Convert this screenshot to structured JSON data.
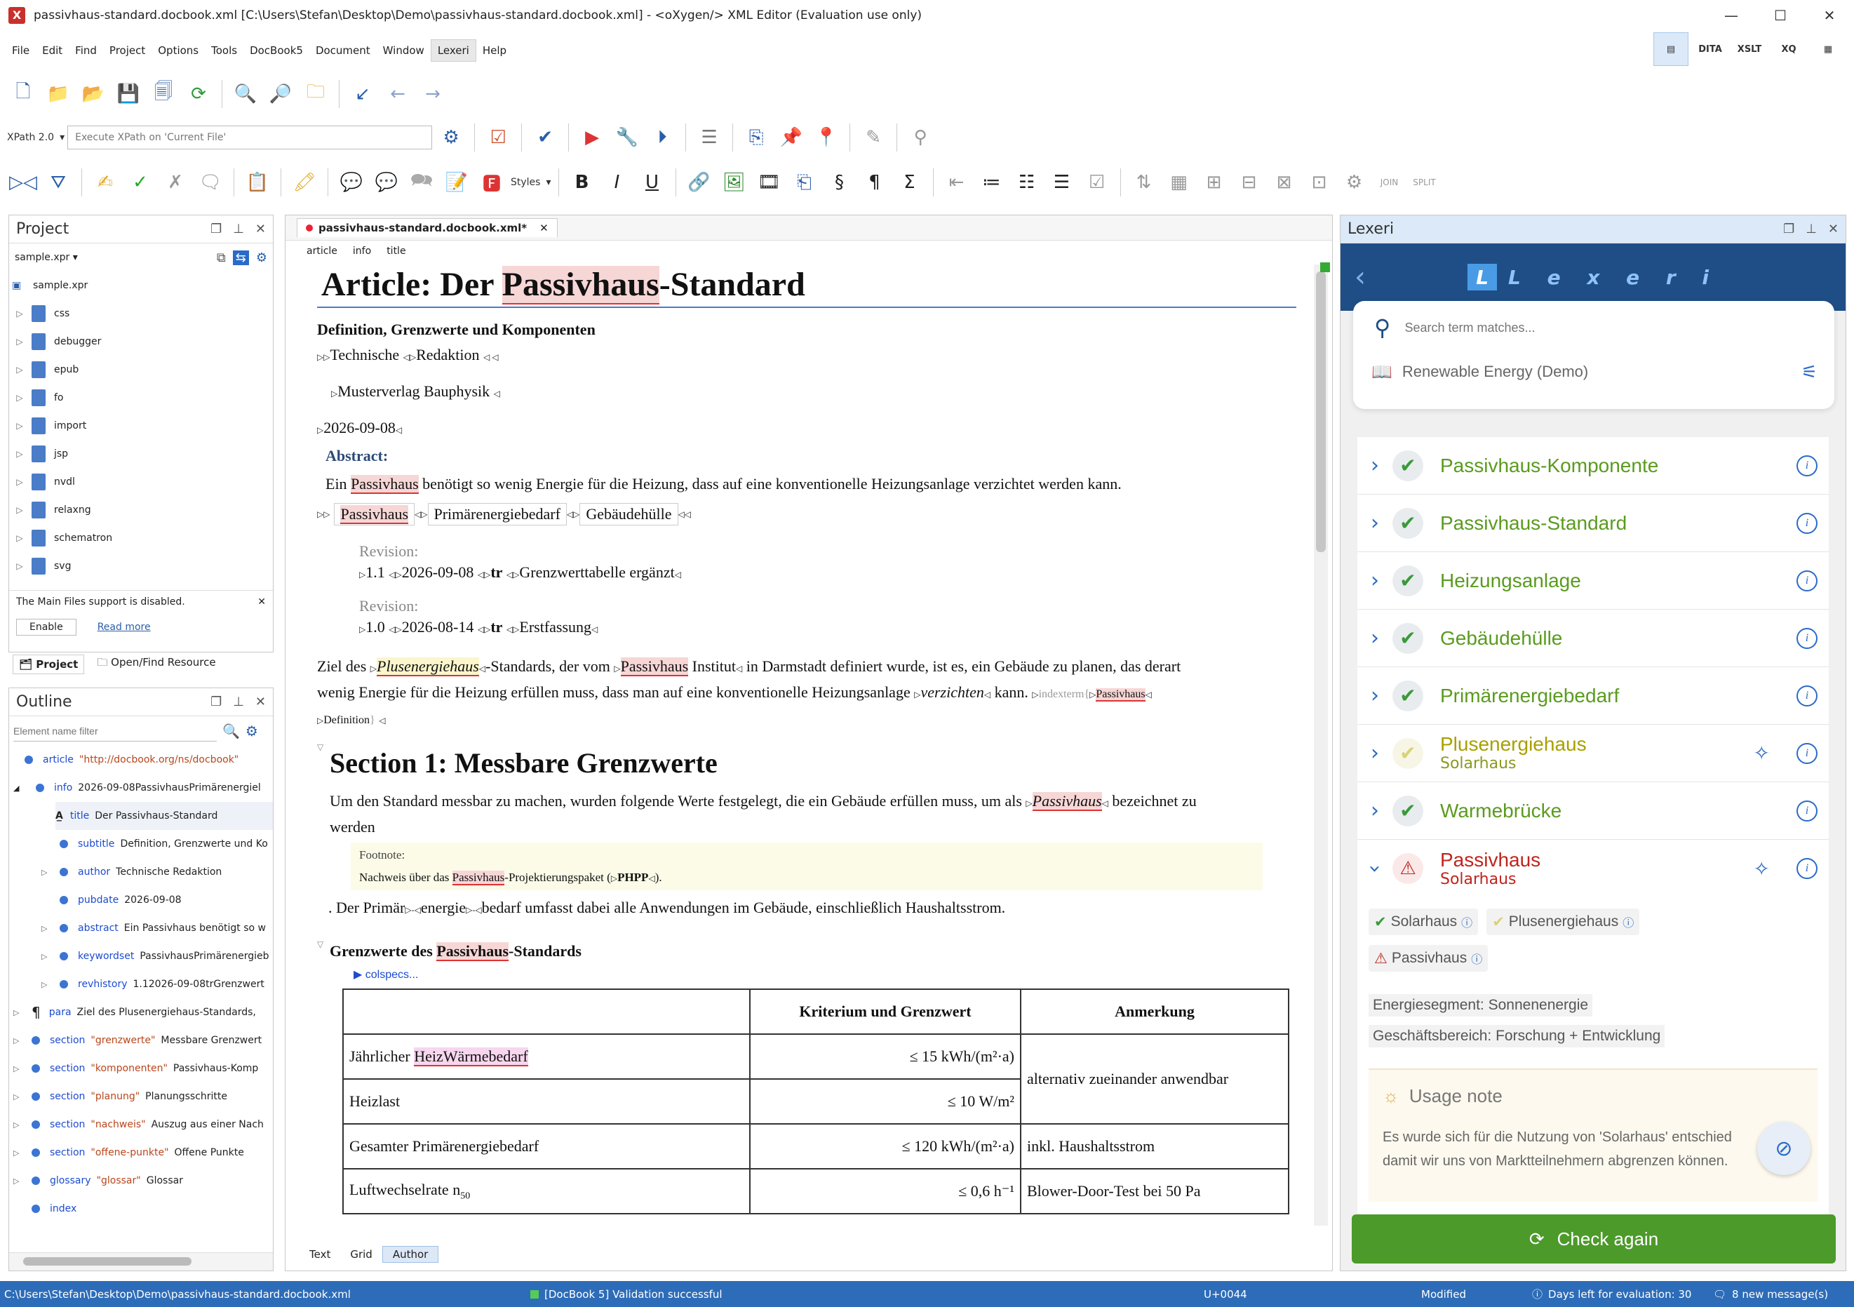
{
  "window": {
    "title": "passivhaus-standard.docbook.xml [C:\\Users\\Stefan\\Desktop\\Demo\\passivhaus-standard.docbook.xml] - <oXygen/> XML Editor (Evaluation use only)",
    "app_icon": "X",
    "minimize": "—",
    "maximize": "☐",
    "close": "✕"
  },
  "menu": [
    "File",
    "Edit",
    "Find",
    "Project",
    "Options",
    "Tools",
    "DocBook5",
    "Document",
    "Window",
    "Lexeri",
    "Help"
  ],
  "perspectives": [
    "",
    "DITA",
    "XSLT",
    "XQ",
    ""
  ],
  "xpath": {
    "version": "XPath 2.0",
    "placeholder": "Execute XPath on  'Current File'"
  },
  "styles_label": "Styles",
  "toolbar3_labels": {
    "join": "JOIN",
    "split": "SPLIT"
  },
  "project": {
    "title": "Project",
    "file": "sample.xpr",
    "items": [
      "sample.xpr",
      "css",
      "debugger",
      "epub",
      "fo",
      "import",
      "jsp",
      "nvdl",
      "relaxng",
      "schematron",
      "svg"
    ],
    "notice": "The Main Files support is disabled.",
    "enable": "Enable",
    "read_more": "Read more",
    "tabs": [
      "Project",
      "Open/Find Resource"
    ]
  },
  "outline": {
    "title": "Outline",
    "filter_placeholder": "Element name filter",
    "rows": [
      {
        "tag": "article",
        "attr": "\"http://docbook.org/ns/docbook\"",
        "text": ""
      },
      {
        "tag": "info",
        "attr": "",
        "text": "2026-09-08PassivhausPrimärenergiel"
      },
      {
        "tag": "title",
        "attr": "",
        "text": "Der Passivhaus-Standard"
      },
      {
        "tag": "subtitle",
        "attr": "",
        "text": "Definition, Grenzwerte und Ko"
      },
      {
        "tag": "author",
        "attr": "",
        "text": "Technische Redaktion"
      },
      {
        "tag": "pubdate",
        "attr": "",
        "text": "2026-09-08"
      },
      {
        "tag": "abstract",
        "attr": "",
        "text": "Ein Passivhaus benötigt so w"
      },
      {
        "tag": "keywordset",
        "attr": "",
        "text": "PassivhausPrimärenergieb"
      },
      {
        "tag": "revhistory",
        "attr": "",
        "text": "1.12026-09-08trGrenzwert"
      },
      {
        "tag": "para",
        "attr": "",
        "text": "Ziel des Plusenergiehaus-Standards,"
      },
      {
        "tag": "section",
        "attr": "\"grenzwerte\"",
        "text": "Messbare Grenzwert"
      },
      {
        "tag": "section",
        "attr": "\"komponenten\"",
        "text": "Passivhaus-Komp"
      },
      {
        "tag": "section",
        "attr": "\"planung\"",
        "text": "Planungsschritte"
      },
      {
        "tag": "section",
        "attr": "\"nachweis\"",
        "text": "Auszug aus einer Nach"
      },
      {
        "tag": "section",
        "attr": "\"offene-punkte\"",
        "text": "Offene Punkte"
      },
      {
        "tag": "glossary",
        "attr": "\"glossar\"",
        "text": "Glossar"
      },
      {
        "tag": "index",
        "attr": "",
        "text": ""
      }
    ]
  },
  "editor": {
    "tab": "passivhaus-standard.docbook.xml*",
    "breadcrumb": [
      "article",
      "info",
      "title"
    ],
    "title_pre": "Article: Der ",
    "title_term": "Passivhaus",
    "title_post": "-Standard",
    "subtitle": "Definition, Grenzwerte und Komponenten",
    "author": [
      "Technische",
      "Redaktion"
    ],
    "publisher": "Musterverlag Bauphysik",
    "pubdate": "2026-09-08",
    "abstract_label": "Abstract:",
    "abstract_pre": "Ein ",
    "abstract_term": "Passivhaus",
    "abstract_post": " benötigt so wenig Energie für die Heizung, dass auf eine konventionelle Heizungsanlage verzichtet werden kann.",
    "keywords": [
      "Passivhaus",
      "Primärenergiebedarf",
      "Gebäudehülle"
    ],
    "revision_label": "Revision:",
    "revisions": [
      {
        "num": "1.1",
        "date": "2026-09-08",
        "by": "tr",
        "remark": "Grenzwerttabelle ergänzt"
      },
      {
        "num": "1.0",
        "date": "2026-08-14",
        "by": "tr",
        "remark": "Erstfassung"
      }
    ],
    "para1": {
      "a": "Ziel des ",
      "b": "Plusenergiehaus",
      "c": "-Standards, der vom ",
      "d": "Passivhaus",
      "e": " Institut",
      "f": " in Darmstadt definiert wurde, ist es, ein Gebäude zu planen, das derart",
      "g": "wenig Energie für die Heizung erfüllen muss, dass man auf eine konventionelle Heizungsanlage ",
      "h": "verzichten",
      "i": " kann. ",
      "j": "indexterm{",
      "k": "Passivhaus",
      "l": "Definition",
      "m": "}"
    },
    "section_title": "Section 1: Messbare Grenzwerte",
    "sec_para_a": "Um den Standard messbar zu machen, wurden folgende Werte festgelegt, die ein Gebäude erfüllen muss, um als ",
    "sec_para_term": "Passivhaus",
    "sec_para_b": " bezeichnet zu",
    "sec_para_c": "werden",
    "footnote_label": "Footnote:",
    "footnote_a": "Nachweis über das ",
    "footnote_term": "Passivhaus",
    "footnote_b": "-Projektierungspaket (",
    "footnote_c": "PHPP",
    "footnote_d": ").",
    "after_fn": ". Der Primär",
    "after_fn2": "energie",
    "after_fn3": "bedarf umfasst dabei alle Anwendungen im Gebäude, einschließlich Haushaltsstrom.",
    "table_title_a": "Grenzwerte des ",
    "table_title_term": "Passivhaus",
    "table_title_b": "-Standards",
    "colspecs": "colspecs...",
    "table": {
      "headers": [
        "",
        "Kriterium und Grenzwert",
        "Anmerkung"
      ],
      "rows": [
        {
          "c1a": "Jährlicher ",
          "c1b": "HeizWärmebedarf",
          "c2": "≤ 15 kWh/(m²·a)",
          "c3": "alternativ zueinander anwendbar"
        },
        {
          "c1a": "Heizlast",
          "c1b": "",
          "c2": "≤ 10 W/m²",
          "c3": ""
        },
        {
          "c1a": "Gesamter Primärenergiebedarf",
          "c1b": "",
          "c2": "≤ 120 kWh/(m²·a)",
          "c3": "inkl. Haushaltsstrom"
        },
        {
          "c1a": "Luftwechselrate n",
          "c1b": "50",
          "c2": "≤ 0,6 h⁻¹",
          "c3": "Blower-Door-Test bei 50 Pa"
        }
      ]
    },
    "bottom_tabs": [
      "Text",
      "Grid",
      "Author"
    ]
  },
  "lexeri": {
    "title": "Lexeri",
    "logo": "L e x e r i",
    "search_placeholder": "Search term matches...",
    "termbase": "Renewable Energy (Demo)",
    "terms": [
      {
        "name": "Passivhaus-Komponente",
        "sub": "",
        "status": "ok"
      },
      {
        "name": "Passivhaus-Standard",
        "sub": "",
        "status": "ok"
      },
      {
        "name": "Heizungsanlage",
        "sub": "",
        "status": "ok"
      },
      {
        "name": "Gebäudehülle",
        "sub": "",
        "status": "ok"
      },
      {
        "name": "Primärenergiebedarf",
        "sub": "",
        "status": "ok"
      },
      {
        "name": "Plusenergiehaus",
        "sub": "Solarhaus",
        "status": "pale"
      },
      {
        "name": "Warmebrücke",
        "sub": "",
        "status": "ok"
      },
      {
        "name": "Passivhaus",
        "sub": "Solarhaus",
        "status": "warn"
      }
    ],
    "chips": [
      {
        "label": "Solarhaus",
        "kind": "ok"
      },
      {
        "label": "Plusenergiehaus",
        "kind": "pale"
      },
      {
        "label": "Passivhaus",
        "kind": "warn"
      }
    ],
    "segment_label": "Energiesegment:",
    "segment_value": "Sonnenenergie",
    "area_label": "Geschäftsbereich:",
    "area_value": "Forschung + Entwicklung",
    "usage_title": "Usage note",
    "usage_text1": "Es wurde sich für die Nutzung von 'Solarhaus' entschied",
    "usage_text2": "damit wir uns von Marktteilnehmern abgrenzen können.",
    "check_again": "Check again",
    "colors": {
      "header": "#1f4e86",
      "ok": "#5a9b1e",
      "warn": "#c0241d",
      "button": "#4c9a2a"
    }
  },
  "status": {
    "path": "C:\\Users\\Stefan\\Desktop\\Demo\\passivhaus-standard.docbook.xml",
    "validation": "[DocBook 5] Validation successful",
    "unicode": "U+0044",
    "modified": "Modified",
    "eval": "Days left for evaluation: 30",
    "messages": "8 new message(s)"
  }
}
